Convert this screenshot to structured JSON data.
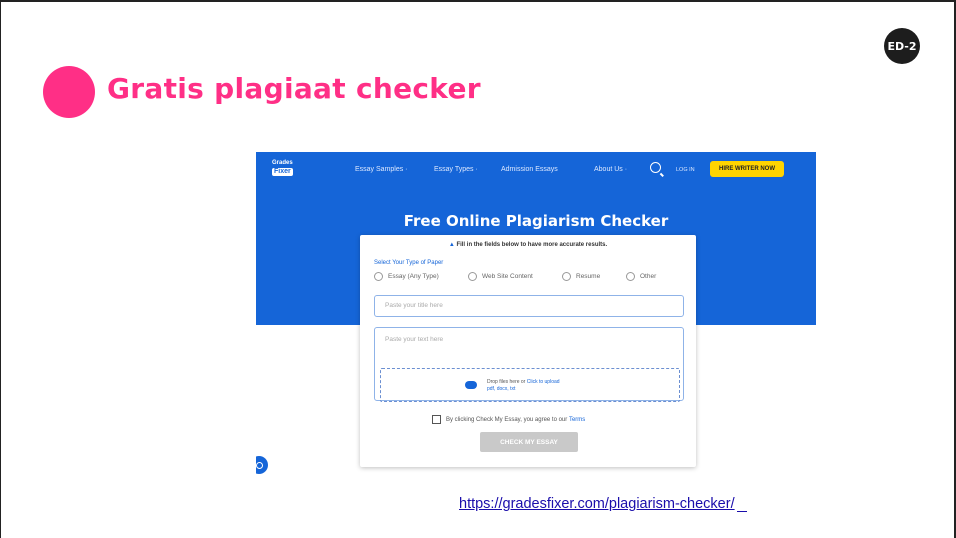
{
  "slide": {
    "badge": "ED-2",
    "title": "Gratis plagiaat checker",
    "link": "https://gradesfixer.com/plagiarism-checker/",
    "accent_color": "#ff2f86"
  },
  "site": {
    "logo_line1": "Grades",
    "logo_line2": "Fixer",
    "nav": [
      "Essay Samples ·",
      "Essay Types ·",
      "Admission Essays",
      "About Us ·"
    ],
    "login": "LOG IN",
    "hire_button": "HIRE WRITER NOW",
    "hero_title": "Free Online Plagiarism Checker",
    "brand_color": "#1565d8"
  },
  "form": {
    "notice": "Fill in the fields below to have more accurate results.",
    "select_label": "Select Your Type of Paper",
    "paper_types": [
      "Essay (Any Type)",
      "Web Site Content",
      "Resume",
      "Other"
    ],
    "title_placeholder": "Paste your title here",
    "text_placeholder": "Paste your text here",
    "drop_text": "Drop files here or",
    "drop_link": "Click to upload",
    "drop_formats": "pdf, docx, txt",
    "agree_text": "By clicking Check My Essay, you agree to our",
    "agree_link": "Terms",
    "submit": "CHECK MY ESSAY"
  }
}
